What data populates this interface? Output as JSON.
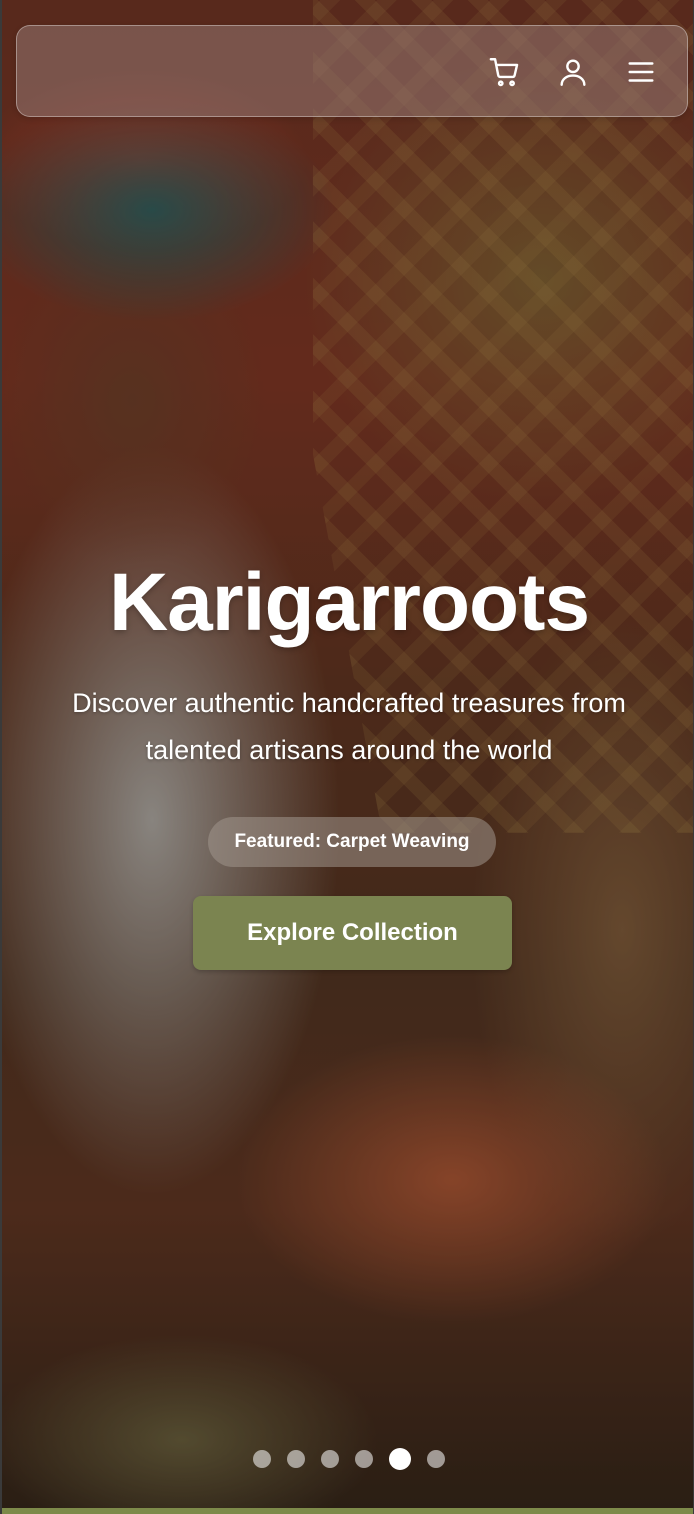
{
  "header": {
    "icons": [
      "cart-icon",
      "user-icon",
      "menu-icon"
    ]
  },
  "hero": {
    "title": "Karigarroots",
    "subtitle": "Discover authentic handcrafted treasures from talented artisans around the world",
    "featured": "Featured: Carpet Weaving",
    "cta_label": "Explore Collection"
  },
  "carousel": {
    "total": 6,
    "active_index": 4
  },
  "colors": {
    "accent": "#7b8450",
    "bottom_line": "#7d8a4a",
    "text": "#ffffff"
  }
}
